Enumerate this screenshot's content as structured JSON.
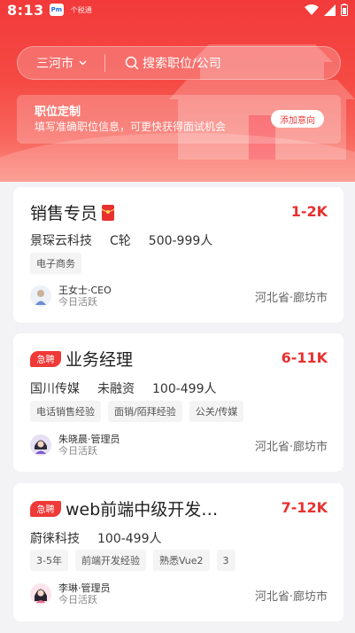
{
  "status_bar": {
    "time": "8:13",
    "app_icon_text": "Pm",
    "app_icon2_text": "个税通"
  },
  "header": {
    "city": "三河市",
    "search_placeholder": "搜索职位/公司"
  },
  "custom_banner": {
    "title": "职位定制",
    "subtitle": "填写准确职位信息，可更快获得面试机会",
    "button": "添加意向"
  },
  "jobs": [
    {
      "title": "销售专员",
      "salary": "1-2K",
      "company": "景琛云科技",
      "funding": "C轮",
      "size": "500-999人",
      "tags": [
        "电子商务"
      ],
      "recruiter": "王女士·CEO",
      "active": "今日活跃",
      "location": "河北省·廊坊市"
    },
    {
      "badge": "急聘",
      "title": "业务经理",
      "salary": "6-11K",
      "company": "国川传媒",
      "funding": "未融资",
      "size": "100-499人",
      "tags": [
        "电话销售经验",
        "面销/陌拜经验",
        "公关/传媒"
      ],
      "recruiter": "朱晓晨·管理员",
      "active": "今日活跃",
      "location": "河北省·廊坊市"
    },
    {
      "badge": "急聘",
      "title": "web前端中级开发…",
      "salary": "7-12K",
      "company": "蔚徕科技",
      "size": "100-499人",
      "tags": [
        "3-5年",
        "前端开发经验",
        "熟悉Vue2",
        "3"
      ],
      "recruiter": "李琳·管理员",
      "active": "今日活跃",
      "location": "河北省·廊坊市"
    }
  ]
}
